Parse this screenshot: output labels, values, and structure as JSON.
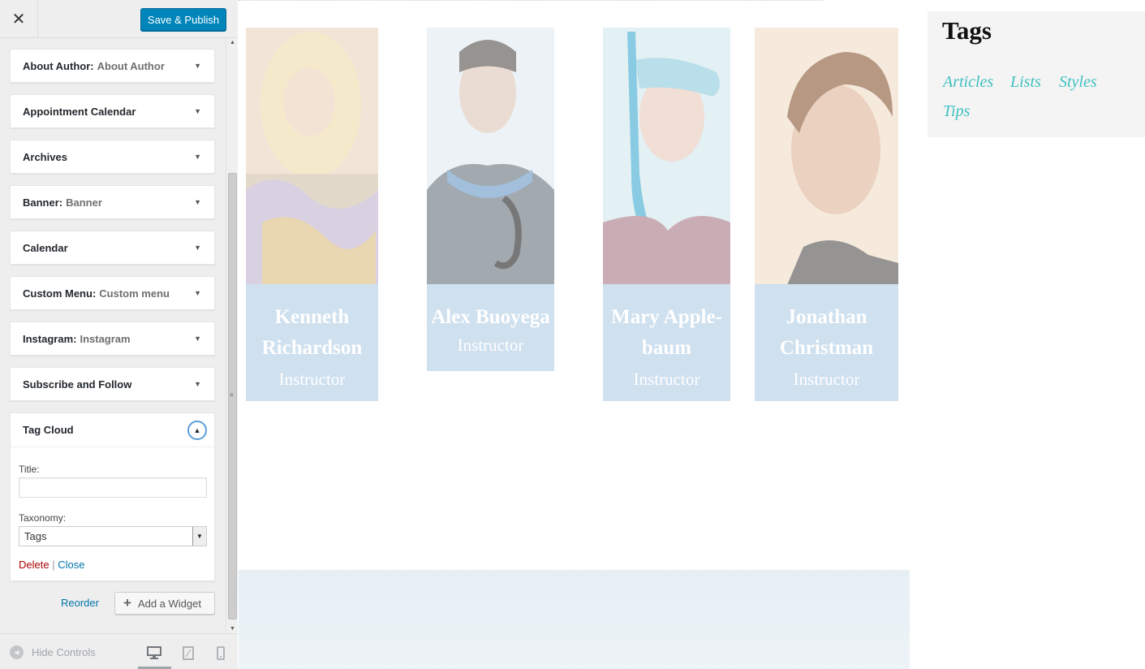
{
  "header": {
    "close_label": "✕",
    "save_label": "Save & Publish"
  },
  "widgets": [
    {
      "name": "About Author:",
      "sub": "About Author"
    },
    {
      "name": "Appointment Calendar",
      "sub": ""
    },
    {
      "name": "Archives",
      "sub": ""
    },
    {
      "name": "Banner:",
      "sub": "Banner"
    },
    {
      "name": "Calendar",
      "sub": ""
    },
    {
      "name": "Custom Menu:",
      "sub": "Custom menu"
    },
    {
      "name": "Instagram:",
      "sub": "Instagram"
    },
    {
      "name": "Subscribe and Follow",
      "sub": ""
    }
  ],
  "tag_cloud": {
    "name": "Tag Cloud",
    "title_label": "Title:",
    "title_value": "",
    "taxonomy_label": "Taxonomy:",
    "taxonomy_value": "Tags",
    "delete_label": "Delete",
    "separator": "|",
    "close_label": "Close"
  },
  "actions": {
    "reorder_label": "Reorder",
    "add_widget_label": "Add a Widget"
  },
  "footer": {
    "hide_controls_label": "Hide Controls"
  },
  "instructors": [
    {
      "name_line1": "Kenneth",
      "name_line2": "Richardson",
      "role": "Instructor"
    },
    {
      "name_line1": "Alex Buoyega",
      "name_line2": "",
      "role": "Instructor"
    },
    {
      "name_line1": "Mary Apple-",
      "name_line2": "baum",
      "role": "Instructor"
    },
    {
      "name_line1": "Jonathan",
      "name_line2": "Christman",
      "role": "Instructor"
    }
  ],
  "sidebar": {
    "title": "Tags",
    "tags": [
      "Articles",
      "Lists",
      "Styles",
      "Tips"
    ]
  },
  "colors": {
    "accent": "#0085ba",
    "link": "#0073aa",
    "delete": "#aa0000",
    "tag": "#3fbfbf",
    "caption_bg": "#cfe0ef"
  }
}
